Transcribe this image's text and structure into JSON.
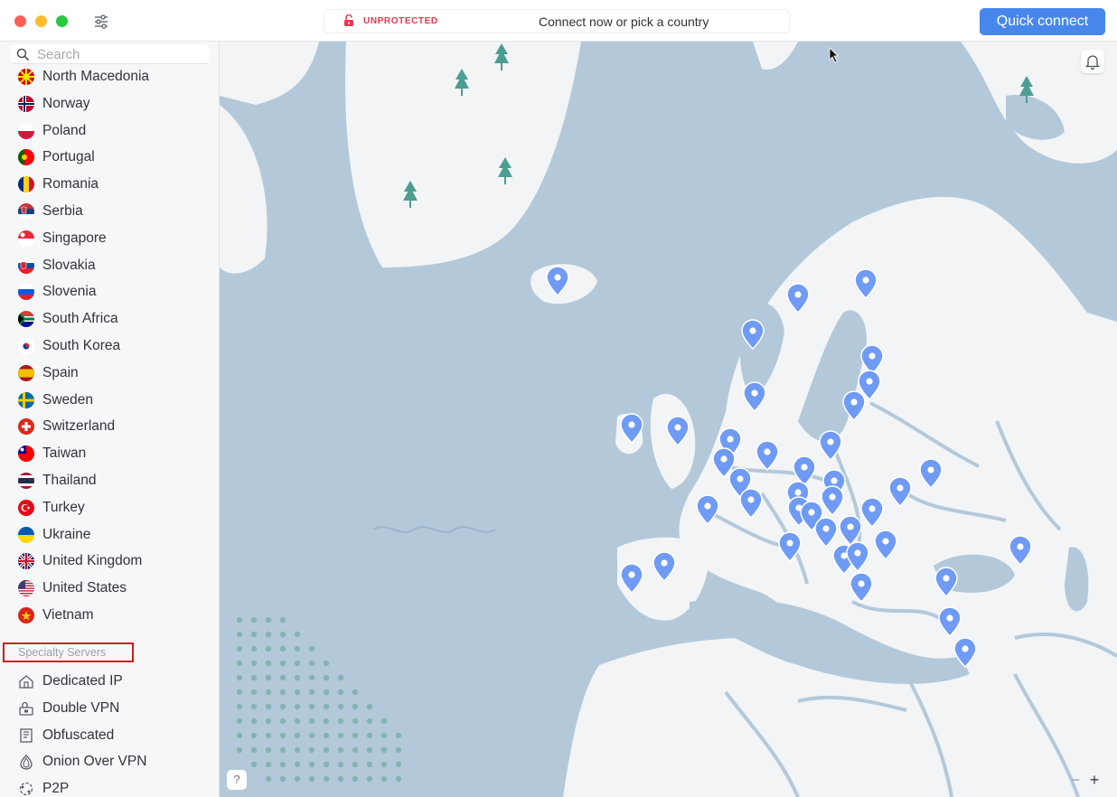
{
  "titlebar": {
    "status_label": "UNPROTECTED",
    "status_text": "Connect now or pick a country",
    "quick_connect_label": "Quick connect",
    "accent_color": "#4787ec",
    "status_color": "#e8374c"
  },
  "sidebar": {
    "search_placeholder": "Search",
    "countries": [
      {
        "name": "North Macedonia",
        "flag": "north-macedonia"
      },
      {
        "name": "Norway",
        "flag": "norway"
      },
      {
        "name": "Poland",
        "flag": "poland"
      },
      {
        "name": "Portugal",
        "flag": "portugal"
      },
      {
        "name": "Romania",
        "flag": "romania"
      },
      {
        "name": "Serbia",
        "flag": "serbia"
      },
      {
        "name": "Singapore",
        "flag": "singapore"
      },
      {
        "name": "Slovakia",
        "flag": "slovakia"
      },
      {
        "name": "Slovenia",
        "flag": "slovenia"
      },
      {
        "name": "South Africa",
        "flag": "south-africa"
      },
      {
        "name": "South Korea",
        "flag": "south-korea"
      },
      {
        "name": "Spain",
        "flag": "spain"
      },
      {
        "name": "Sweden",
        "flag": "sweden"
      },
      {
        "name": "Switzerland",
        "flag": "switzerland"
      },
      {
        "name": "Taiwan",
        "flag": "taiwan"
      },
      {
        "name": "Thailand",
        "flag": "thailand"
      },
      {
        "name": "Turkey",
        "flag": "turkey"
      },
      {
        "name": "Ukraine",
        "flag": "ukraine"
      },
      {
        "name": "United Kingdom",
        "flag": "united-kingdom"
      },
      {
        "name": "United States",
        "flag": "united-states"
      },
      {
        "name": "Vietnam",
        "flag": "vietnam"
      }
    ],
    "specialty_label": "Specialty Servers",
    "specialty": [
      {
        "name": "Dedicated IP",
        "icon": "home-icon"
      },
      {
        "name": "Double VPN",
        "icon": "double-lock-icon"
      },
      {
        "name": "Obfuscated",
        "icon": "obfuscated-icon"
      },
      {
        "name": "Onion Over VPN",
        "icon": "onion-icon"
      },
      {
        "name": "P2P",
        "icon": "p2p-icon"
      }
    ]
  },
  "map": {
    "help_label": "?",
    "zoom_out_label": "−",
    "zoom_in_label": "+",
    "land_color": "#f2f4f6",
    "sea_color": "#b3c9da",
    "pin_color": "#6f9bf5",
    "tree_color": "#4c9e92"
  }
}
